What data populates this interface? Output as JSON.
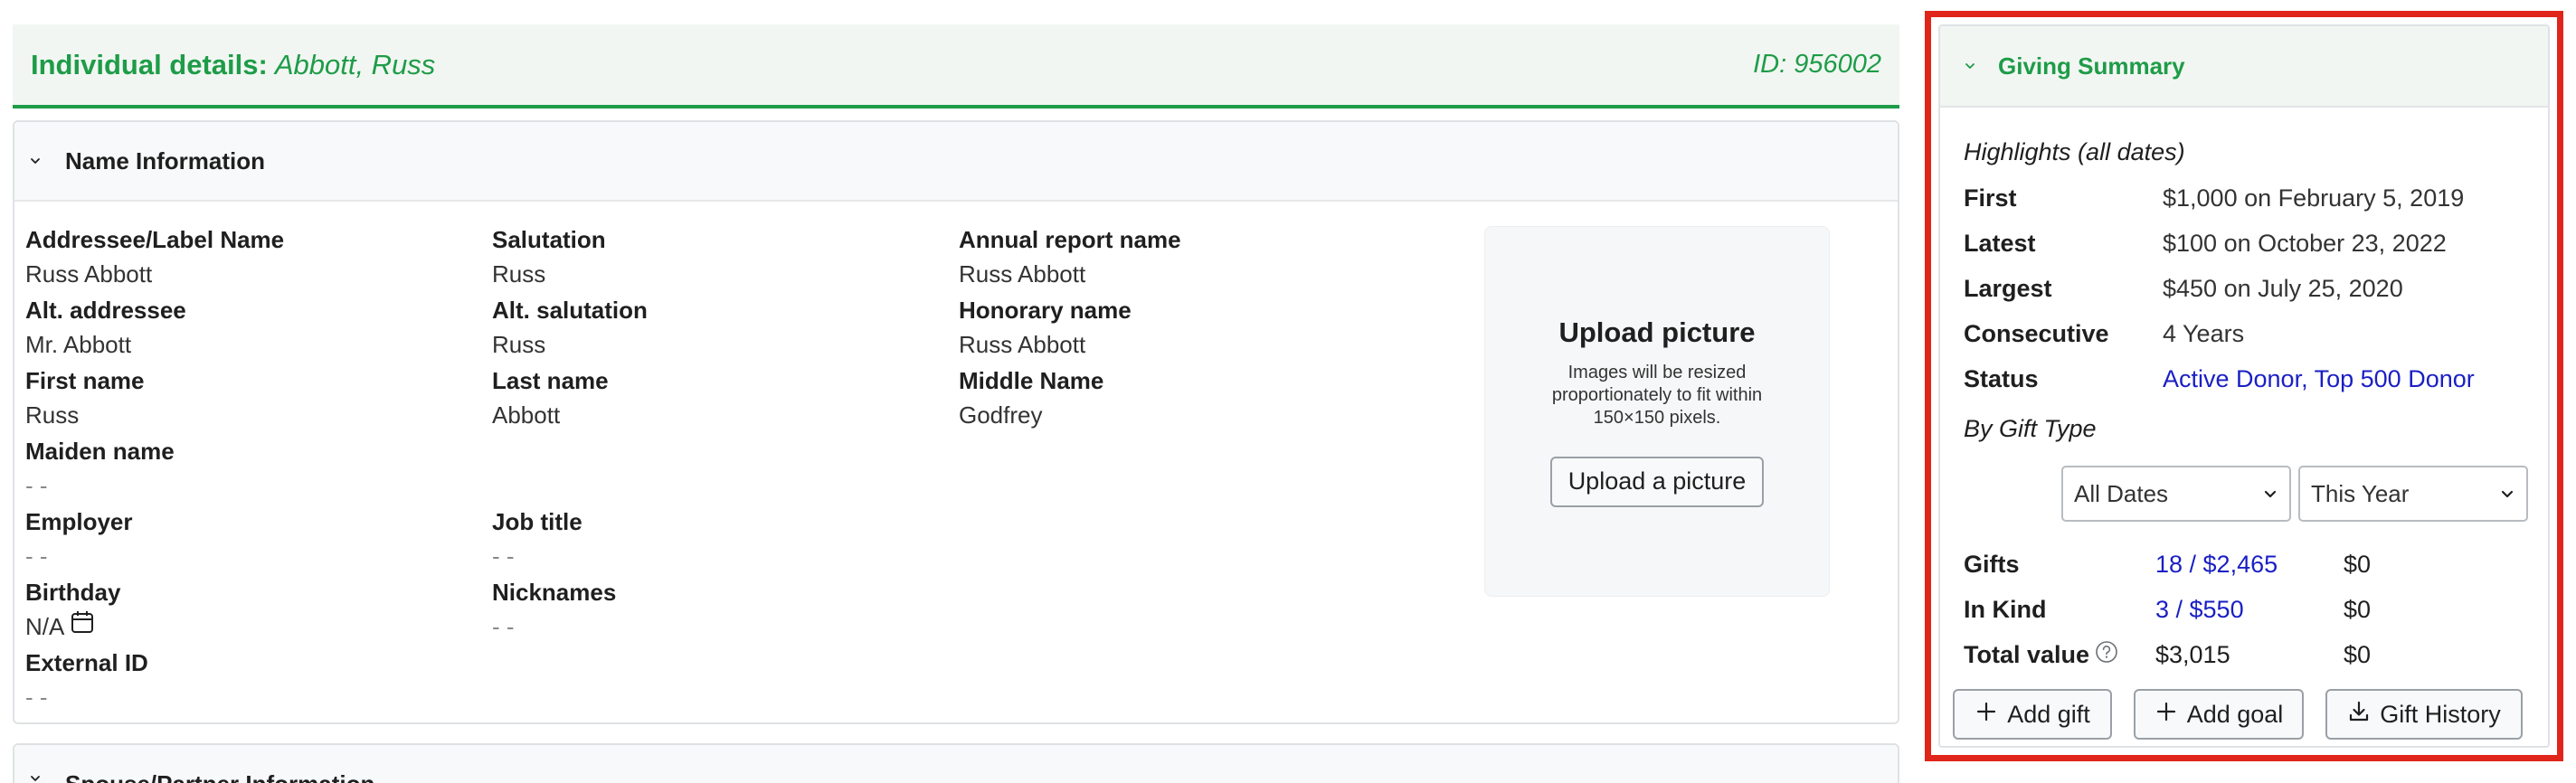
{
  "header": {
    "label": "Individual details:",
    "name": "Abbott, Russ",
    "id": "ID: 956002"
  },
  "name_info": {
    "title": "Name Information",
    "fields": {
      "addressee_label": "Addressee/Label Name",
      "addressee_value": "Russ Abbott",
      "salutation_label": "Salutation",
      "salutation_value": "Russ",
      "annual_label": "Annual report name",
      "annual_value": "Russ Abbott",
      "alt_addressee_label": "Alt. addressee",
      "alt_addressee_value": "Mr. Abbott",
      "alt_salutation_label": "Alt. salutation",
      "alt_salutation_value": "Russ",
      "honorary_label": "Honorary name",
      "honorary_value": "Russ Abbott",
      "first_label": "First name",
      "first_value": "Russ",
      "last_label": "Last name",
      "last_value": "Abbott",
      "middle_label": "Middle Name",
      "middle_value": "Godfrey",
      "maiden_label": "Maiden name",
      "maiden_value": "- -",
      "employer_label": "Employer",
      "employer_value": "- -",
      "job_label": "Job title",
      "job_value": "- -",
      "birthday_label": "Birthday",
      "birthday_value": "N/A",
      "nicknames_label": "Nicknames",
      "nicknames_value": "- -",
      "external_label": "External ID",
      "external_value": "- -"
    },
    "upload": {
      "title": "Upload picture",
      "description": "Images will be resized proportionately to fit within 150×150 pixels.",
      "button": "Upload a picture"
    }
  },
  "spouse": {
    "title": "Spouse/Partner Information"
  },
  "giving": {
    "title": "Giving Summary",
    "highlights_heading": "Highlights (all dates)",
    "highlights": [
      {
        "k": "First",
        "v": "$1,000 on February 5, 2019"
      },
      {
        "k": "Latest",
        "v": "$100 on October 23, 2022"
      },
      {
        "k": "Largest",
        "v": "$450 on July 25, 2020"
      },
      {
        "k": "Consecutive",
        "v": "4 Years"
      }
    ],
    "status_label": "Status",
    "status_active": "Active Donor",
    "status_sep": ",",
    "status_top": "Top 500 Donor",
    "by_type_heading": "By Gift Type",
    "select_all": "All Dates",
    "select_year": "This Year",
    "gifts_label": "Gifts",
    "gifts_all": "18 / $2,465",
    "gifts_year": "$0",
    "inkind_label": "In Kind",
    "inkind_all": "3 / $550",
    "inkind_year": "$0",
    "total_label": "Total value",
    "total_all": "$3,015",
    "total_year": "$0",
    "add_gift": "Add gift",
    "add_goal": "Add goal",
    "history": "Gift History",
    "accent_color": "#1e9c48",
    "highlight_border_color": "#e0251b",
    "link_color": "#1a1fc4"
  }
}
